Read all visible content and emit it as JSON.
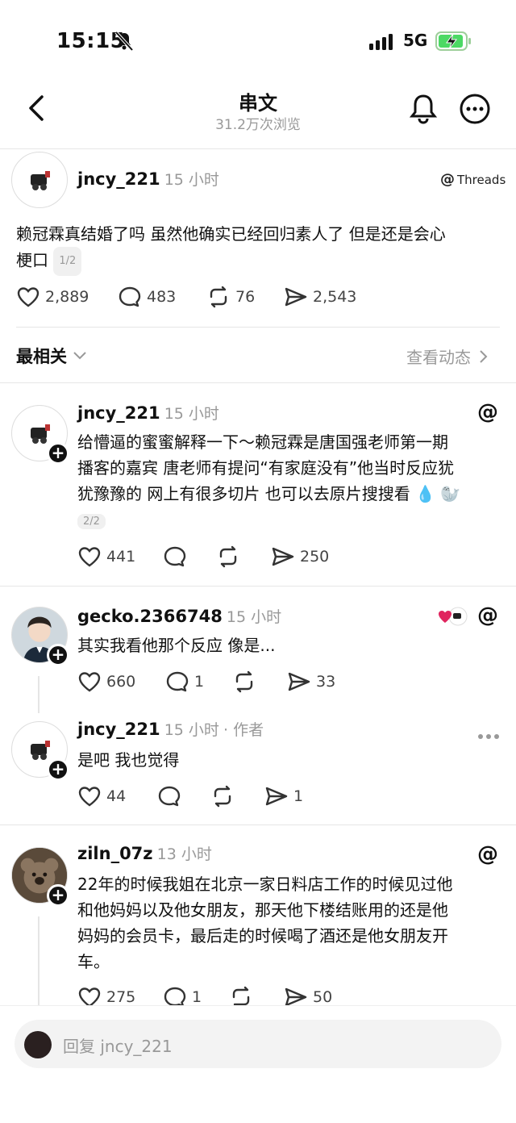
{
  "status_bar": {
    "time": "15:15",
    "network": "5G"
  },
  "header": {
    "title": "串文",
    "views": "31.2万次浏览"
  },
  "main_post": {
    "username": "jncy_221",
    "time": "15 小时",
    "source": "Threads",
    "text_line1": "赖冠霖真结婚了吗 虽然他确实已经回归素人了 但是还是会心",
    "text_line2": "梗口",
    "page": "1/2",
    "likes": "2,889",
    "comments": "483",
    "reposts": "76",
    "shares": "2,543"
  },
  "sort": {
    "label": "最相关",
    "activity_link": "查看动态"
  },
  "replies": [
    {
      "username": "jncy_221",
      "time": "15 小时",
      "lines": [
        "给懵逼的蜜蜜解释一下～赖冠霖是唐国强老师第一期",
        "播客的嘉宾 唐老师有提问“有家庭没有”他当时反应犹",
        "犹豫豫的 网上有很多切片 也可以去原片搜搜看 💧 🦭"
      ],
      "page": "2/2",
      "likes": "441",
      "shares": "250"
    },
    {
      "username": "gecko.2366748",
      "time": "15 小时",
      "text": "其实我看他那个反应 像是...",
      "likes": "660",
      "comments": "1",
      "shares": "33"
    },
    {
      "username": "jncy_221",
      "time": "15 小时",
      "author_tag": "· 作者",
      "text": "是吧 我也觉得",
      "likes": "44",
      "shares": "1"
    },
    {
      "username": "ziln_07z",
      "time": "13 小时",
      "lines": [
        "22年的时候我姐在北京一家日料店工作的时候见过他",
        "和他妈妈以及他女朋友，那天他下楼结账用的还是他",
        "妈妈的会员卡，最后走的时候喝了酒还是他女朋友开",
        "车。"
      ],
      "likes": "275",
      "comments": "1",
      "shares": "50"
    }
  ],
  "reply_box": {
    "placeholder": "回复 jncy_221"
  },
  "colors": {
    "heart": "#e0245e",
    "text_secondary": "#999999"
  },
  "icons": [
    "bell-off-icon",
    "signal-icon",
    "battery-charging-icon",
    "back-arrow-icon",
    "bell-icon",
    "more-icon",
    "threads-icon",
    "heart-icon",
    "comment-icon",
    "repost-icon",
    "share-icon",
    "chevron-down-icon",
    "chevron-right-icon",
    "plus-icon"
  ]
}
